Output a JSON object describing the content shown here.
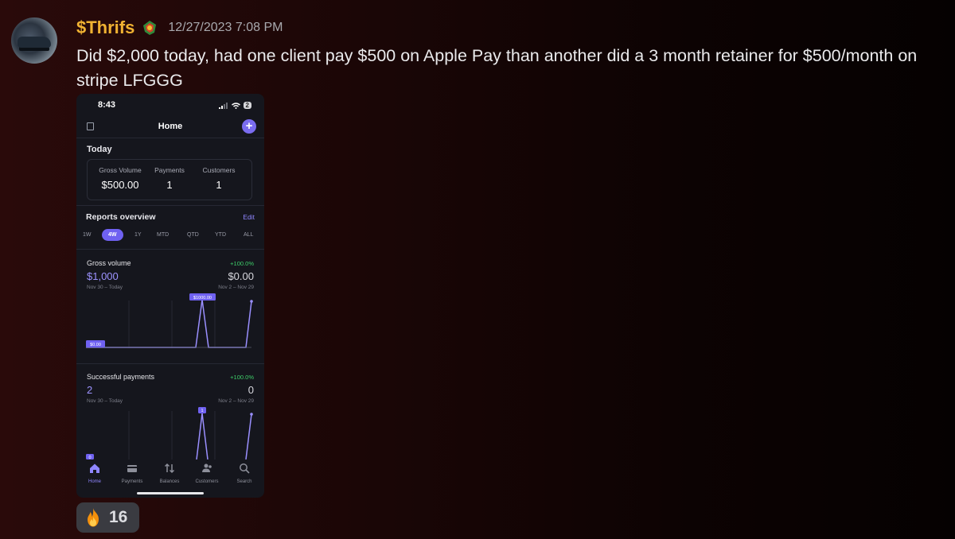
{
  "message": {
    "username": "$Thrifs",
    "timestamp": "12/27/2023 7:08 PM",
    "text": "Did $2,000 today, had one client pay $500 on Apple Pay than another did a 3 month retainer for $500/month on stripe LFGGG",
    "username_color": "#f0b232",
    "reaction": {
      "emoji": "fire",
      "count": "16"
    }
  },
  "phone": {
    "status_time": "8:43",
    "battery": "2",
    "nav_title": "Home",
    "today": {
      "title": "Today",
      "stats": [
        {
          "label": "Gross Volume",
          "value": "$500.00"
        },
        {
          "label": "Payments",
          "value": "1"
        },
        {
          "label": "Customers",
          "value": "1"
        }
      ]
    },
    "reports": {
      "title": "Reports overview",
      "edit": "Edit",
      "ranges": [
        "1W",
        "4W",
        "1Y",
        "MTD",
        "QTD",
        "YTD",
        "ALL"
      ],
      "active_range": "4W"
    },
    "gross_volume": {
      "title": "Gross volume",
      "change": "+100.0%",
      "current": "$1,000",
      "previous": "$0.00",
      "current_period": "Nov 30 – Today",
      "previous_period": "Nov 2 – Nov 29",
      "peak_label": "$1000.00",
      "base_label": "$0.00"
    },
    "successful_payments": {
      "title": "Successful payments",
      "change": "+100.0%",
      "current": "2",
      "previous": "0",
      "current_period": "Nov 30 – Today",
      "previous_period": "Nov 2 – Nov 29",
      "peak_label": "1",
      "base_label": "0"
    },
    "tabs": [
      {
        "label": "Home",
        "icon": "home-icon",
        "active": true
      },
      {
        "label": "Payments",
        "icon": "payments-icon",
        "active": false
      },
      {
        "label": "Balances",
        "icon": "balances-icon",
        "active": false
      },
      {
        "label": "Customers",
        "icon": "customers-icon",
        "active": false
      },
      {
        "label": "Search",
        "icon": "search-icon",
        "active": false
      }
    ],
    "accent": "#6f61f1",
    "positive": "#3ecf6a"
  }
}
